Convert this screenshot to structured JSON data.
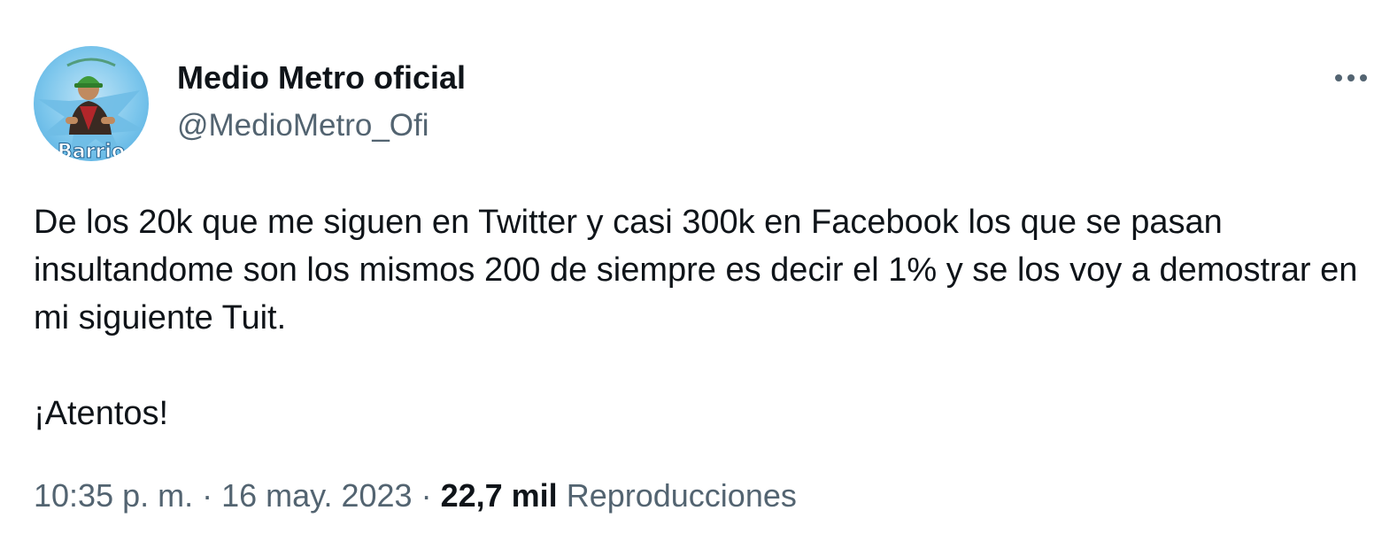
{
  "tweet": {
    "author": {
      "display_name": "Medio Metro oficial",
      "handle": "@MedioMetro_Ofi",
      "avatar_text": "Barrio"
    },
    "more_icon": "more-horizontal-icon",
    "body": {
      "paragraph_1": "De los 20k que me siguen en Twitter y casi 300k en Facebook los que se pasan insultandome son los mismos 200 de siempre es decir el 1% y se los voy a demostrar en mi siguiente Tuit.",
      "paragraph_2": "¡Atentos!"
    },
    "meta": {
      "time": "10:35 p. m.",
      "separator_1": " · ",
      "date": "16 may. 2023",
      "separator_2": " · ",
      "views_count": "22,7 mil",
      "views_label": "Reproducciones"
    }
  },
  "colors": {
    "text_primary": "#0f1419",
    "text_secondary": "#536471",
    "avatar_bg": "#7cc6ec"
  }
}
